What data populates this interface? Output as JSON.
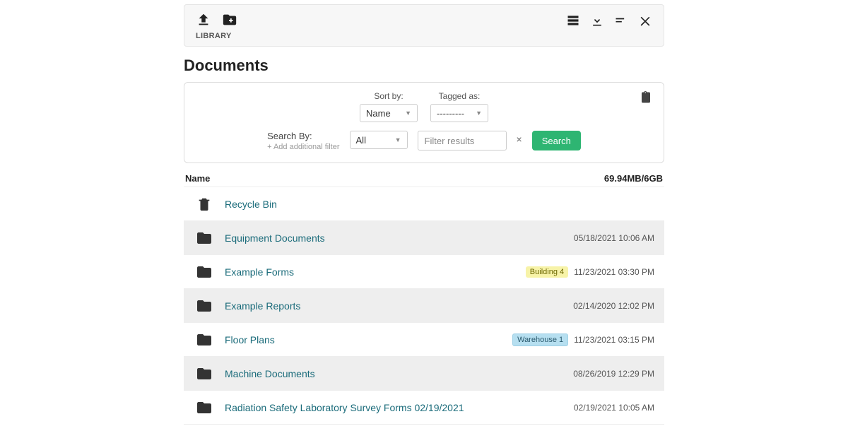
{
  "toolbar": {
    "library_label": "LIBRARY"
  },
  "page_title": "Documents",
  "filters": {
    "sort_by_label": "Sort by:",
    "sort_by_value": "Name",
    "tagged_as_label": "Tagged as:",
    "tagged_as_value": "---------",
    "search_by_label": "Search By:",
    "add_filter_label": "+ Add additional filter",
    "search_by_value": "All",
    "filter_placeholder": "Filter results",
    "clear_symbol": "×",
    "search_button": "Search"
  },
  "list_header": {
    "name": "Name",
    "storage": "69.94MB/6GB"
  },
  "rows": [
    {
      "icon": "trash",
      "name": "Recycle Bin",
      "tag": null,
      "tag_style": null,
      "timestamp": ""
    },
    {
      "icon": "folder",
      "name": "Equipment Documents",
      "tag": null,
      "tag_style": null,
      "timestamp": "05/18/2021 10:06 AM"
    },
    {
      "icon": "folder",
      "name": "Example Forms",
      "tag": "Building 4",
      "tag_style": "yellow",
      "timestamp": "11/23/2021 03:30 PM"
    },
    {
      "icon": "folder",
      "name": "Example Reports",
      "tag": null,
      "tag_style": null,
      "timestamp": "02/14/2020 12:02 PM"
    },
    {
      "icon": "folder",
      "name": "Floor Plans",
      "tag": "Warehouse 1",
      "tag_style": "blue",
      "timestamp": "11/23/2021 03:15 PM"
    },
    {
      "icon": "folder",
      "name": "Machine Documents",
      "tag": null,
      "tag_style": null,
      "timestamp": "08/26/2019 12:29 PM"
    },
    {
      "icon": "folder",
      "name": "Radiation Safety Laboratory Survey Forms 02/19/2021",
      "tag": null,
      "tag_style": null,
      "timestamp": "02/19/2021 10:05 AM"
    }
  ]
}
